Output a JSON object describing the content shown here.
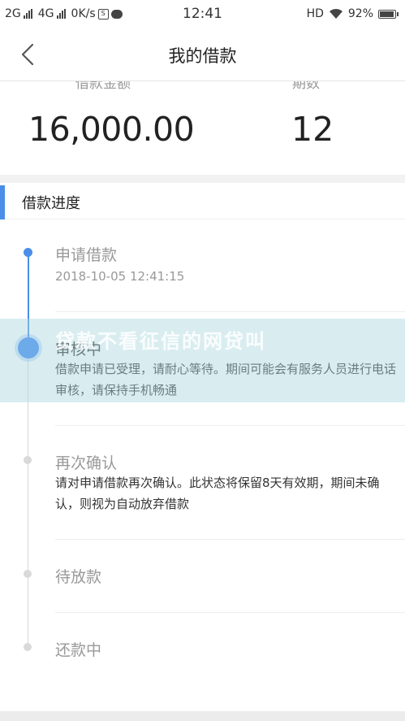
{
  "status_bar": {
    "sim1": "2G",
    "sim2": "4G",
    "speed": "0K/s",
    "time": "12:41",
    "hd": "HD",
    "battery": "92%",
    "battery_level": 0.92
  },
  "nav": {
    "title": "我的借款"
  },
  "summary": {
    "amount_label": "借款金额",
    "periods_label": "期数",
    "amount": "16,000.00",
    "periods": "12"
  },
  "progress": {
    "title": "借款进度",
    "steps": [
      {
        "title": "申请借款",
        "time": "2018-10-05 12:41:15",
        "state": "done"
      },
      {
        "title": "审核中",
        "desc": "借款申请已受理，请耐心等待。期间可能会有服务人员进行电话审核，请保持手机畅通",
        "state": "current"
      },
      {
        "title": "再次确认",
        "desc": "请对申请借款再次确认。此状态将保留8天有效期，期间未确认，则视为自动放弃借款",
        "state": "pending"
      },
      {
        "title": "待放款",
        "state": "pending"
      },
      {
        "title": "还款中",
        "state": "pending"
      }
    ]
  },
  "watermark": {
    "text": "贷款不看征信的网贷叫"
  },
  "colors": {
    "accent": "#4a8ee8",
    "current_dot": "#3a86f0",
    "pending_dot": "#d9d9d9"
  }
}
